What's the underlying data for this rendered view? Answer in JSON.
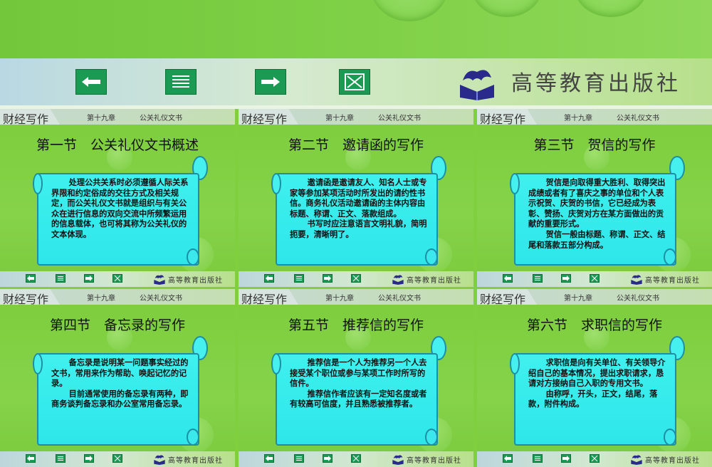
{
  "toolbar": {
    "prev_icon": "arrow-left-icon",
    "menu_icon": "list-icon",
    "next_icon": "arrow-right-icon",
    "close_icon": "close-x-icon"
  },
  "publisher": {
    "name": "高等教育出版社",
    "logo_icon": "dragon-book-logo-icon"
  },
  "slide_common": {
    "brand": "财经写作",
    "chapter": "第十九章",
    "subject": "公关礼仪文书",
    "footer_publisher": "高等教育出版社"
  },
  "slides": [
    {
      "title": "第一节　公关礼仪文书概述",
      "paragraphs": [
        "处理公共关系时必须遵循人际关系界限和约定俗成的交往方式及相关规定，而公关礼仪文书就是组织与有关公众在进行信息的双向交流中所频繁运用的信息载体，也可将其称为公关礼仪的文本体现。"
      ]
    },
    {
      "title": "第二节　邀请函的写作",
      "paragraphs": [
        "邀请函是邀请友人、知名人士或专家等参加某项活动时所发出的请约性书信。商务礼仪活动邀请函的主体内容由标题、称谓、正文、落款组成。",
        "书写时应注意语言文明礼貌，简明扼要，清晰明了。"
      ]
    },
    {
      "title": "第三节　贺信的写作",
      "paragraphs": [
        "贺信是向取得重大胜利、取得突出成绩或者有了喜庆之事的单位和个人表示祝贺、庆贺的书信，它已经成为表彰、赞扬、庆贺对方在某方面做出的贡献的重要形式。",
        "贺信一般由标题、称谓、正文、结尾和落款五部分构成。"
      ]
    },
    {
      "title": "第四节　备忘录的写作",
      "paragraphs": [
        "备忘录是说明某一问题事实经过的文书，常用来作为帮助、唤起记忆的记录。",
        "目前通常使用的备忘录有两种，即商务谈判备忘录和办公室常用备忘录。"
      ]
    },
    {
      "title": "第五节　推荐信的写作",
      "paragraphs": [
        "推荐信是一个人为推荐另一个人去接受某个职位或参与某项工作时所写的信件。",
        "推荐信作者应该有一定知名度或者有较高可信度，并且熟悉被推荐者。"
      ]
    },
    {
      "title": "第六节　求职信的写作",
      "paragraphs": [
        "求职信是向有关单位、有关领导介绍自己的基本情况，提出求职请求，恳请对方接纳自己入职的专用文书。",
        "由称呼，开头，正文，结尾，落款，附件构成。"
      ]
    }
  ]
}
